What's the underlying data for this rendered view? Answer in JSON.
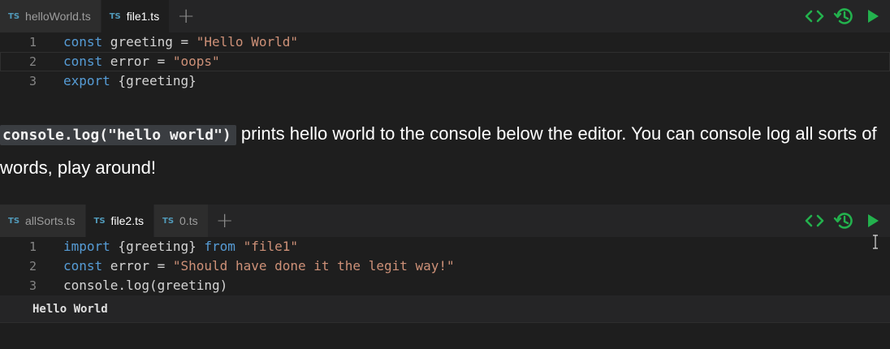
{
  "colors": {
    "background": "#1e1e1e",
    "tabbar": "#252526",
    "keyword": "#569cd6",
    "string": "#ce9178",
    "action_green": "#23b14d"
  },
  "editors": [
    {
      "tabs": [
        {
          "icon": "TS",
          "label": "helloWorld.ts",
          "active": false
        },
        {
          "icon": "TS",
          "label": "file1.ts",
          "active": true
        }
      ],
      "add_tab_label": "+",
      "toolbar_icons": [
        "code-brackets-icon",
        "history-icon",
        "run-icon"
      ],
      "lines": [
        {
          "number": "1",
          "tokens": [
            {
              "kind": "kw",
              "text": "const"
            },
            {
              "kind": "plain",
              "text": " greeting = "
            },
            {
              "kind": "str",
              "text": "\"Hello World\""
            }
          ]
        },
        {
          "number": "2",
          "tokens": [
            {
              "kind": "kw",
              "text": "const"
            },
            {
              "kind": "plain",
              "text": " error = "
            },
            {
              "kind": "str",
              "text": "\"oops\""
            }
          ]
        },
        {
          "number": "3",
          "tokens": [
            {
              "kind": "kw",
              "text": "export"
            },
            {
              "kind": "plain",
              "text": " {greeting}"
            }
          ]
        }
      ]
    },
    {
      "tabs": [
        {
          "icon": "TS",
          "label": "allSorts.ts",
          "active": false
        },
        {
          "icon": "TS",
          "label": "file2.ts",
          "active": true
        },
        {
          "icon": "TS",
          "label": "0.ts",
          "active": false
        }
      ],
      "add_tab_label": "+",
      "toolbar_icons": [
        "code-brackets-icon",
        "history-icon",
        "run-icon"
      ],
      "lines": [
        {
          "number": "1",
          "tokens": [
            {
              "kind": "kw",
              "text": "import"
            },
            {
              "kind": "plain",
              "text": " {greeting} "
            },
            {
              "kind": "kw",
              "text": "from"
            },
            {
              "kind": "plain",
              "text": " "
            },
            {
              "kind": "str",
              "text": "\"file1\""
            }
          ]
        },
        {
          "number": "2",
          "tokens": [
            {
              "kind": "kw",
              "text": "const"
            },
            {
              "kind": "plain",
              "text": " error = "
            },
            {
              "kind": "str",
              "text": "\"Should have done it the legit way!\""
            }
          ]
        },
        {
          "number": "3",
          "tokens": [
            {
              "kind": "plain",
              "text": "console.log(greeting)"
            }
          ]
        }
      ],
      "console_output": "Hello World"
    }
  ],
  "prose": {
    "inline_code": "console.log(\"hello world\")",
    "text": " prints hello world to the console below the editor. You can console log all sorts of words, play around!"
  }
}
